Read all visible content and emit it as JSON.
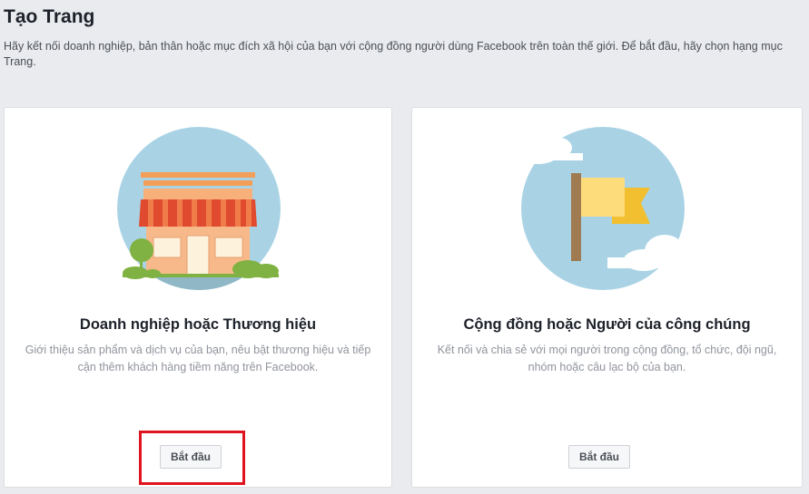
{
  "header": {
    "title": "Tạo Trang",
    "description": "Hãy kết nối doanh nghiệp, bản thân hoặc mục đích xã hội của bạn với cộng đồng người dùng Facebook trên toàn thế giới. Để bắt đầu, hãy chọn hạng mục Trang."
  },
  "cards": [
    {
      "title": "Doanh nghiệp hoặc Thương hiệu",
      "description": "Giới thiệu sản phẩm và dịch vụ của bạn, nêu bật thương hiệu và tiếp cận thêm khách hàng tiềm năng trên Facebook.",
      "button_label": "Bắt đầu",
      "illustration": "storefront-icon"
    },
    {
      "title": "Cộng đồng hoặc Người của công chúng",
      "description": "Kết nối và chia sẻ với mọi người trong cộng đồng, tổ chức, đội ngũ, nhóm hoặc câu lạc bộ của bạn.",
      "button_label": "Bắt đầu",
      "illustration": "flag-icon"
    }
  ],
  "colors": {
    "background": "#e9ebee",
    "highlight": "#e0141e",
    "circle": "#a9d3e5"
  }
}
